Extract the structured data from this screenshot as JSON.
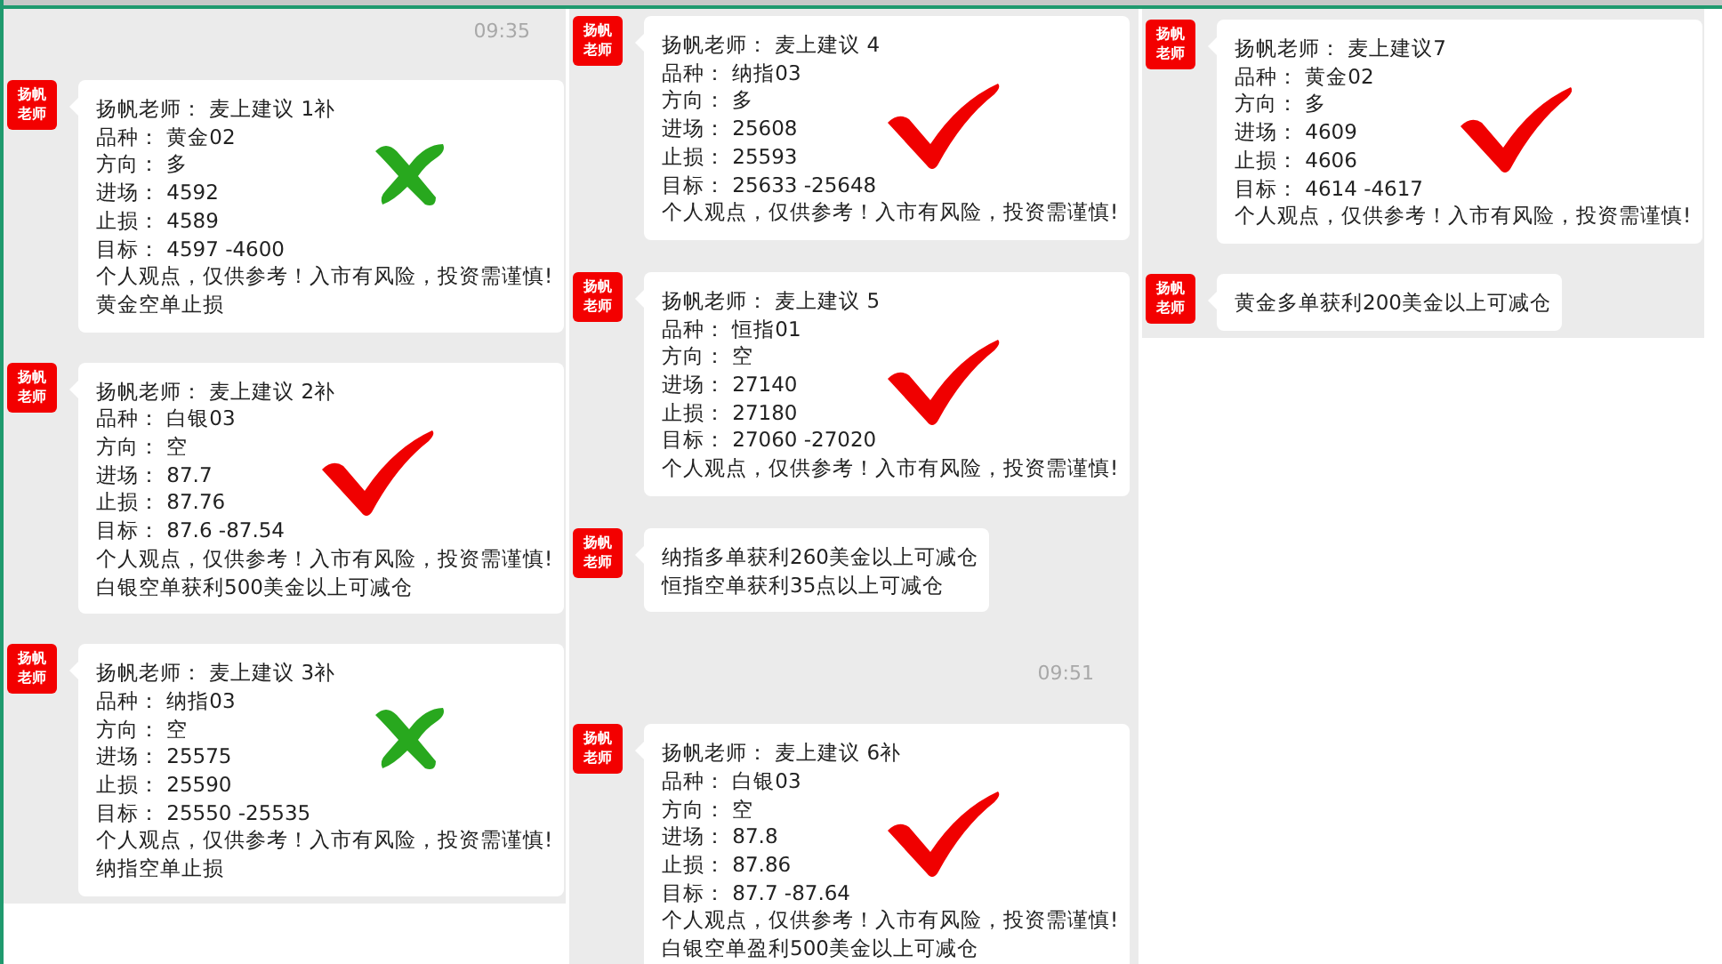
{
  "columns": [
    {
      "items": [
        {
          "kind": "time",
          "text": "09:35"
        },
        {
          "kind": "message",
          "avatar": [
            "扬帆",
            "老师"
          ],
          "correct": false,
          "lines": [
            "扬帆老师：  麦上建议 1补",
            "品种：  黄金02",
            "方向：  多",
            "进场：  4592",
            "止损：  4589",
            "目标：  4597 -4600",
            "个人观点，仅供参考！入市有风险，投资需谨慎!",
            "黄金空单止损"
          ]
        },
        {
          "kind": "message",
          "avatar": [
            "扬帆",
            "老师"
          ],
          "correct": true,
          "lines": [
            "扬帆老师：  麦上建议 2补",
            "品种：  白银03",
            "方向：  空",
            "进场：  87.7",
            "止损：  87.76",
            "目标：  87.6 -87.54",
            "个人观点，仅供参考！入市有风险，投资需谨慎!",
            "白银空单获利500美金以上可减仓"
          ]
        },
        {
          "kind": "message",
          "avatar": [
            "扬帆",
            "老师"
          ],
          "correct": false,
          "lines": [
            "扬帆老师：  麦上建议 3补",
            "品种：  纳指03",
            "方向：  空",
            "进场：  25575",
            "止损：  25590",
            "目标：  25550 -25535",
            "个人观点，仅供参考！入市有风险，投资需谨慎!",
            "纳指空单止损"
          ]
        }
      ]
    },
    {
      "items": [
        {
          "kind": "message",
          "avatar": [
            "扬帆",
            "老师"
          ],
          "correct": true,
          "lines": [
            "扬帆老师：  麦上建议 4",
            "品种：  纳指03",
            "方向：  多",
            "进场：  25608",
            "止损：  25593",
            "目标：  25633 -25648",
            "个人观点，仅供参考！入市有风险，投资需谨慎!"
          ]
        },
        {
          "kind": "message",
          "avatar": [
            "扬帆",
            "老师"
          ],
          "correct": true,
          "lines": [
            "扬帆老师：  麦上建议 5",
            "品种：  恒指01",
            "方向：  空",
            "进场：  27140",
            "止损：  27180",
            "目标：  27060 -27020",
            "个人观点，仅供参考！入市有风险，投资需谨慎!"
          ]
        },
        {
          "kind": "message",
          "avatar": [
            "扬帆",
            "老师"
          ],
          "lines": [
            "纳指多单获利260美金以上可减仓",
            "恒指空单获利35点以上可减仓"
          ]
        },
        {
          "kind": "time",
          "text": "09:51"
        },
        {
          "kind": "message",
          "avatar": [
            "扬帆",
            "老师"
          ],
          "correct": true,
          "lines": [
            "扬帆老师：  麦上建议 6补",
            "品种：  白银03",
            "方向：  空",
            "进场：  87.8",
            "止损：  87.86",
            "目标：  87.7 -87.64",
            "个人观点，仅供参考！入市有风险，投资需谨慎!",
            "白银空单盈利500美金以上可减仓"
          ]
        }
      ]
    },
    {
      "items": [
        {
          "kind": "message",
          "avatar": [
            "扬帆",
            "老师"
          ],
          "correct": true,
          "lines": [
            "扬帆老师：  麦上建议7",
            "品种：  黄金02",
            "方向：  多",
            "进场：  4609",
            "止损：  4606",
            "目标：  4614 -4617",
            "个人观点，仅供参考！入市有风险，投资需谨慎!"
          ]
        },
        {
          "kind": "message",
          "avatar": [
            "扬帆",
            "老师"
          ],
          "lines": [
            "黄金多单获利200美金以上可减仓"
          ]
        }
      ]
    }
  ]
}
